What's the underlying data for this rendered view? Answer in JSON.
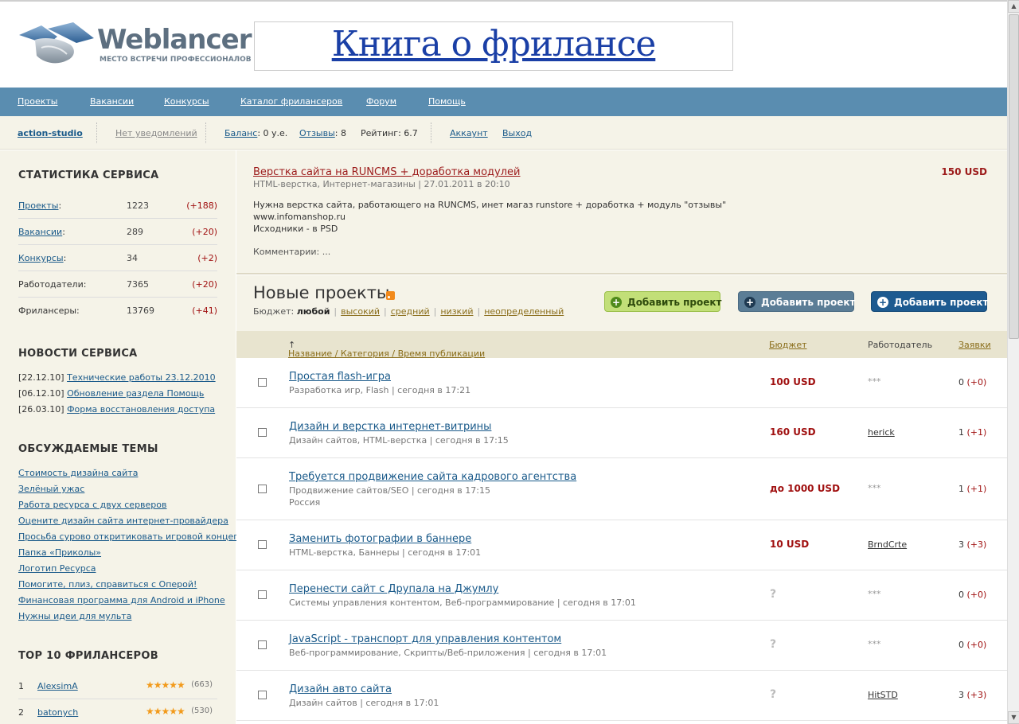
{
  "header": {
    "logo_word": "Weblancer",
    "logo_tagline": "МЕСТО ВСТРЕЧИ ПРОФЕССИОНАЛОВ",
    "banner_text": "Книга о фрилансе"
  },
  "nav": [
    "Проекты",
    "Вакансии",
    "Конкурсы",
    "Каталог фрилансеров",
    "Форум",
    "Помощь"
  ],
  "userbar": {
    "username": "action-studio",
    "notifications": "Нет уведомлений",
    "balance_label": "Баланс",
    "balance_value": ": 0 у.е.",
    "reviews_label": "Отзывы",
    "reviews_value": ": 8",
    "rating": "Рейтинг: 6.7",
    "account": "Аккаунт",
    "logout": "Выход"
  },
  "sidebar": {
    "stats_title": "СТАТИСТИКА СЕРВИСА",
    "stats": [
      {
        "label": "Проекты",
        "suffix": ":",
        "value": "1223",
        "delta": "(+188)",
        "link": true
      },
      {
        "label": "Вакансии",
        "suffix": ":",
        "value": "289",
        "delta": "(+20)",
        "link": true
      },
      {
        "label": "Конкурсы",
        "suffix": ":",
        "value": "34",
        "delta": "(+2)",
        "link": true
      },
      {
        "label": "Работодатели:",
        "suffix": "",
        "value": "7365",
        "delta": "(+20)",
        "link": false
      },
      {
        "label": "Фрилансеры:",
        "suffix": "",
        "value": "13769",
        "delta": "(+41)",
        "link": false
      }
    ],
    "news_title": "НОВОСТИ СЕРВИСА",
    "news": [
      {
        "date": "[22.12.10]",
        "text": "Технические работы 23.12.2010"
      },
      {
        "date": "[06.12.10]",
        "text": "Обновление раздела Помощь"
      },
      {
        "date": "[26.03.10]",
        "text": "Форма восстановления доступа"
      }
    ],
    "topics_title": "ОБСУЖДАЕМЫЕ ТЕМЫ",
    "topics": [
      "Стоимость дизайна сайта",
      "Зелёный ужас",
      "Работа ресурса с двух серверов",
      "Оцените дизайн сайта интернет-провайдера",
      "Просьба сурово откритиковать игровой концепт",
      "Папка «Приколы»",
      "Логотип Ресурса",
      "Помогите, плиз, справиться с Оперой!",
      "Финансовая программа для Android и iPhone",
      "Нужны идеи для мульта"
    ],
    "top_title": "TOP 10 ФРИЛАНСЕРОВ",
    "top": [
      {
        "n": "1",
        "name": "AlexsimA",
        "stars": "★★★★★",
        "count": "(663)",
        "rating": 5
      },
      {
        "n": "2",
        "name": "batonych",
        "stars": "★★★★★",
        "count": "(530)",
        "rating": 5
      }
    ]
  },
  "featured": {
    "title": "Верстка сайта на RUNCMS + доработка модулей",
    "price": "150 USD",
    "meta": "HTML-верстка, Интернет-магазины | 27.01.2011 в 20:10",
    "desc_lines": [
      "Нужна верстка сайта, работающего на RUNCMS, инет магаз runstore + доработка + модуль \"отзывы\"",
      "www.infomanshop.ru",
      "Исходники - в PSD"
    ],
    "comments": "Комментарии: ..."
  },
  "new_projects": {
    "title": "Новые проекты",
    "budget_label": "Бюджет:",
    "budget_current": "любой",
    "budget_options": [
      "высокий",
      "средний",
      "низкий",
      "неопределенный"
    ],
    "buttons": [
      "Добавить проект",
      "Добавить проект",
      "Добавить проект"
    ],
    "columns": {
      "name": "Название / Категория / Время публикации",
      "sort_arrow": "↑",
      "budget": "Бюджет",
      "employer": "Работодатель",
      "bids": "Заявки"
    },
    "rows": [
      {
        "title": "Простая flash-игра",
        "meta": "Разработка игр, Flash | сегодня в 17:21",
        "location": "",
        "price": "100 USD",
        "employer": "***",
        "bids": "0",
        "bids_delta": "(+0)"
      },
      {
        "title": "Дизайн и верстка интернет-витрины",
        "meta": "Дизайн сайтов, HTML-верстка | сегодня в 17:15",
        "location": "",
        "price": "160 USD",
        "employer": "herick",
        "bids": "1",
        "bids_delta": "(+1)"
      },
      {
        "title": "Требуется продвижение сайта кадрового агентства",
        "meta": "Продвижение сайтов/SEO | сегодня в 17:15",
        "location": "Россия",
        "price": "до 1000 USD",
        "employer": "***",
        "bids": "1",
        "bids_delta": "(+1)"
      },
      {
        "title": "Заменить фотографии в баннере",
        "meta": "HTML-верстка, Баннеры | сегодня в 17:01",
        "location": "",
        "price": "10 USD",
        "employer": "BrndCrte",
        "bids": "3",
        "bids_delta": "(+3)"
      },
      {
        "title": "Перенести сайт с Друпала на Джумлу",
        "meta": "Системы управления контентом, Веб-программирование | сегодня в 17:01",
        "location": "",
        "price": "?",
        "employer": "***",
        "bids": "0",
        "bids_delta": "(+0)"
      },
      {
        "title": "JavaScript - транспорт для управления контентом",
        "meta": "Веб-программирование, Скрипты/Веб-приложения | сегодня в 17:01",
        "location": "",
        "price": "?",
        "employer": "***",
        "bids": "0",
        "bids_delta": "(+0)"
      },
      {
        "title": "Дизайн авто сайта",
        "meta": "Дизайн сайтов | сегодня в 17:01",
        "location": "",
        "price": "?",
        "employer": "HitSTD",
        "bids": "3",
        "bids_delta": "(+3)"
      }
    ]
  },
  "colors": {
    "nav_bg": "#5a8db0",
    "panel_bg": "#f5f3e8",
    "price_red": "#a01010",
    "link_blue": "#1a5a8a"
  }
}
